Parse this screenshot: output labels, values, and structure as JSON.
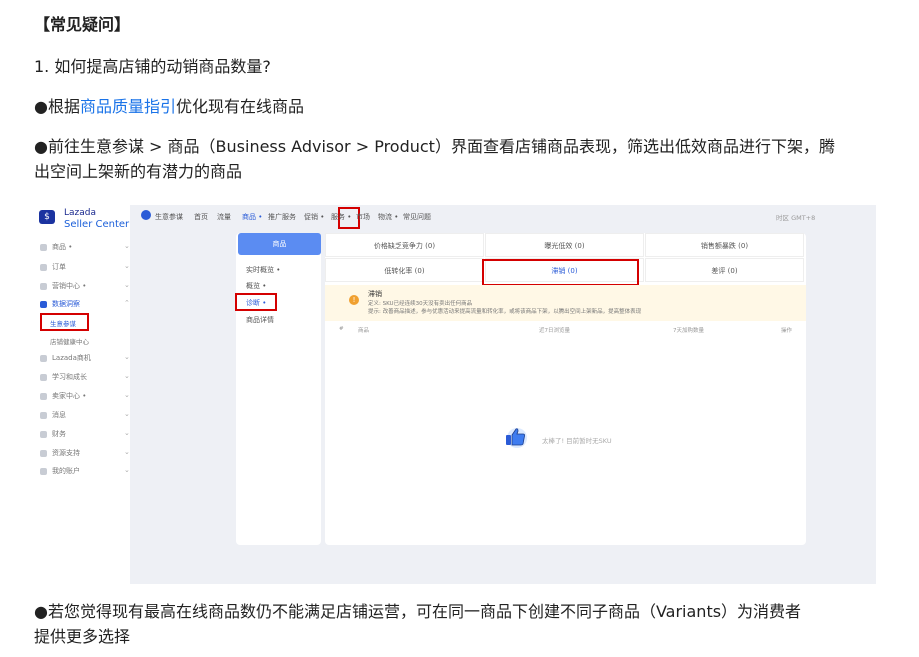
{
  "doc": {
    "heading": "【常见疑问】",
    "q1": "1. 如何提高店铺的动销商品数量?",
    "b1_prefix": "●根据",
    "b1_link": "商品质量指引",
    "b1_suffix": "优化现有在线商品",
    "b2_line1": "●前往生意参谋 > 商品（Business Advisor > Product）界面查看店铺商品表现，筛选出低效商品进行下架，腾",
    "b2_line2": "出空间上架新的有潜力的商品",
    "b3_line1": "●若您觉得现有最高在线商品数仍不能满足店铺运营，可在同一商品下创建不同子商品（Variants）为消费者",
    "b3_line2": "提供更多选择"
  },
  "screenshot": {
    "logo_line1": "Lazada",
    "logo_line2": "Seller Center",
    "sidebar": [
      {
        "label": "商品 •",
        "active": false
      },
      {
        "label": "订单",
        "active": false
      },
      {
        "label": "营销中心 •",
        "active": false
      },
      {
        "label": "数据洞察",
        "active": true
      },
      {
        "label": "生意参谋",
        "sub": true,
        "selected": true
      },
      {
        "label": "店铺健康中心",
        "sub": true,
        "selected": false
      },
      {
        "label": "Lazada商机",
        "active": false
      },
      {
        "label": "学习和成长",
        "active": false
      },
      {
        "label": "卖家中心 •",
        "active": false
      },
      {
        "label": "消息",
        "active": false
      },
      {
        "label": "财务",
        "active": false
      },
      {
        "label": "资源支持",
        "active": false
      },
      {
        "label": "我的账户",
        "active": false
      }
    ],
    "topbar": {
      "title": "生意参谋",
      "items": [
        "首页",
        "流量",
        "商品 •",
        "推广服务",
        "促销 •",
        "服务 •",
        "市场",
        "物流 •",
        "常见问题"
      ],
      "right": "时区 GMT+8"
    },
    "leftnav": {
      "tab": "商品",
      "items": [
        "实时概览 •",
        "概览 •",
        "诊断 •",
        "商品详情"
      ]
    },
    "tabs_row1": [
      "价格缺乏竞争力 (0)",
      "曝光低效 (0)",
      "销售额暴跌 (0)"
    ],
    "tabs_row2": [
      "低转化率 (0)",
      "滞销 (0)",
      "差评 (0)"
    ],
    "notice": {
      "icon": "!",
      "title": "滞销",
      "line1": "定义: SKU已经连续30天没有卖出任何商品",
      "line2": "提示: 改善商品描述，参与优惠活动来提高流量和转化率，或将该商品下架，以腾出空间上架新品，提高整体表现"
    },
    "table_headers": [
      "#",
      "商品",
      "近7日浏览量",
      "7天加购数量",
      "操作"
    ],
    "empty_text": "太棒了! 目前暂时无SKU"
  },
  "colors": {
    "link": "#1a73e8",
    "accent": "#2a5bd7",
    "highlight_box": "#d40000"
  }
}
